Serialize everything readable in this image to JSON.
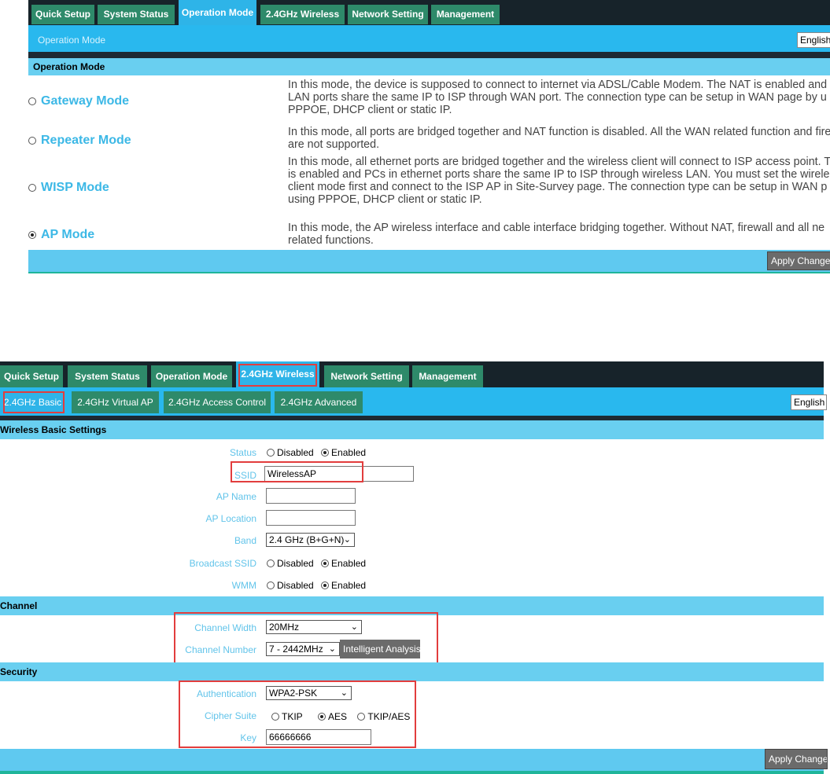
{
  "top": {
    "nav_tabs": [
      "Quick Setup",
      "System Status",
      "Operation Mode",
      "2.4GHz Wireless",
      "Network Setting",
      "Management"
    ],
    "subtitle": "Operation Mode",
    "language": "English",
    "section_title": "Operation Mode",
    "modes": [
      {
        "label": "Gateway Mode",
        "selected": false,
        "desc": [
          "In this mode, the device is supposed to connect to internet via ADSL/Cable Modem. The NAT is enabled and",
          "LAN ports share the same IP to ISP through WAN port. The connection type can be setup in WAN page by u",
          "PPPOE, DHCP client or static IP."
        ]
      },
      {
        "label": "Repeater Mode",
        "selected": false,
        "desc": [
          "In this mode, all ports are bridged together and NAT function is disabled. All the WAN related function and fire",
          "are not supported."
        ]
      },
      {
        "label": "WISP Mode",
        "selected": false,
        "desc": [
          "In this mode, all ethernet ports are bridged together and the wireless client will connect to ISP access point. T",
          "is enabled and PCs in ethernet ports share the same IP to ISP through wireless LAN. You must set the wirele",
          "client mode first and connect to the ISP AP in Site-Survey page. The connection type can be setup in WAN p",
          "using PPPOE, DHCP client or static IP."
        ]
      },
      {
        "label": "AP Mode",
        "selected": true,
        "desc": [
          "In this mode, the AP wireless interface and cable interface bridging together. Without NAT, firewall and all ne",
          "related functions."
        ]
      }
    ],
    "apply_label": "Apply Changes"
  },
  "bottom": {
    "nav_tabs": [
      "Quick Setup",
      "System Status",
      "Operation Mode",
      "2.4GHz Wireless",
      "Network Setting",
      "Management"
    ],
    "sub_tabs": [
      "2.4GHz Basic",
      "2.4GHz Virtual AP",
      "2.4GHz Access Control",
      "2.4GHz Advanced"
    ],
    "language": "English",
    "section_basic": "Wireless Basic Settings",
    "status_label": "Status",
    "disabled": "Disabled",
    "enabled": "Enabled",
    "ssid_label": "SSID",
    "ssid_value": "WirelessAP",
    "ap_name_label": "AP Name",
    "ap_name_value": "",
    "ap_location_label": "AP Location",
    "ap_location_value": "",
    "band_label": "Band",
    "band_value": "2.4 GHz (B+G+N)",
    "broadcast_label": "Broadcast SSID",
    "wmm_label": "WMM",
    "section_channel": "Channel",
    "channel_width_label": "Channel Width",
    "channel_width_value": "20MHz",
    "channel_number_label": "Channel Number",
    "channel_number_value": "7 - 2442MHz",
    "intelligent_label": "Intelligent Analysis",
    "section_security": "Security",
    "auth_label": "Authentication",
    "auth_value": "WPA2-PSK",
    "cipher_label": "Cipher Suite",
    "cipher_options": [
      "TKIP",
      "AES",
      "TKIP/AES"
    ],
    "key_label": "Key",
    "key_value": "66666666",
    "apply_label": "Apply Changes"
  },
  "colors": {
    "nav_bg": "#17232a",
    "tab_bg": "#2e8a6a",
    "tab_active": "#2eb4e8",
    "section_head": "#69cff0",
    "label_blue": "#62c4ea",
    "highlight_red": "#e23d3d"
  }
}
